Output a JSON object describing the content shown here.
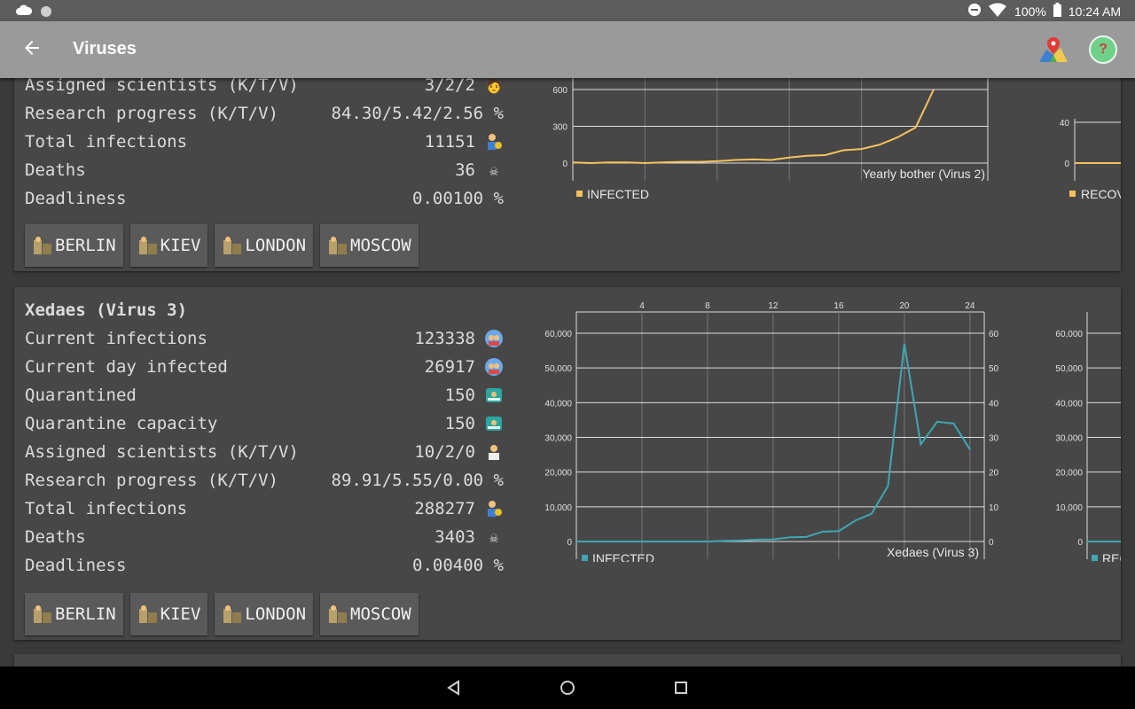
{
  "status": {
    "battery": "100%",
    "time": "10:24 AM"
  },
  "appbar": {
    "title": "Viruses",
    "back_icon": "arrow-left-icon",
    "map_icon": "map-pin-icon",
    "help_label": "?"
  },
  "card_top": {
    "rows": [
      {
        "label": "Assigned scientists (K/T/V)",
        "value": "3/2/2",
        "icon": "scientist-icon"
      },
      {
        "label": "Research progress (K/T/V)",
        "value": "84.30/5.42/2.56 %",
        "icon": ""
      },
      {
        "label": "Total infections",
        "value": "11151",
        "icon": "person-virus-icon"
      },
      {
        "label": "Deaths",
        "value": "36",
        "icon": "skull-icon"
      },
      {
        "label": "Deadliness",
        "value": "0.00100 %",
        "icon": ""
      }
    ],
    "buttons": [
      "BERLIN",
      "KIEV",
      "LONDON",
      "MOSCOW"
    ],
    "chart_caption": "Yearly bother (Virus 2)",
    "legend_infected": "INFECTED",
    "legend_recovered": "RECOVI"
  },
  "card_virus3": {
    "title": "Xedaes (Virus 3)",
    "rows": [
      {
        "label": "Current infections",
        "value": "123338",
        "icon": "people-icon"
      },
      {
        "label": "Current day infected",
        "value": "26917",
        "icon": "people-icon"
      },
      {
        "label": "Quarantined",
        "value": "150",
        "icon": "quarantine-icon"
      },
      {
        "label": "Quarantine capacity",
        "value": "150",
        "icon": "quarantine-icon"
      },
      {
        "label": "Assigned scientists (K/T/V)",
        "value": "10/2/0",
        "icon": "scientist-icon"
      },
      {
        "label": "Research progress (K/T/V)",
        "value": "89.91/5.55/0.00 %",
        "icon": ""
      },
      {
        "label": "Total infections",
        "value": "288277",
        "icon": "person-virus-icon"
      },
      {
        "label": "Deaths",
        "value": "3403",
        "icon": "skull-icon"
      },
      {
        "label": "Deadliness",
        "value": "0.00400 %",
        "icon": ""
      }
    ],
    "buttons": [
      "BERLIN",
      "KIEV",
      "LONDON",
      "MOSCOW"
    ],
    "chart_caption": "Xedaes (Virus 3)",
    "legend_infected": "INFECTED",
    "legend_recovered": "RECO"
  },
  "chart_data": [
    {
      "type": "line",
      "title": "Yearly bother (Virus 2)",
      "series": [
        {
          "name": "INFECTED",
          "color": "#f5c15c",
          "x": [
            1,
            2,
            3,
            4,
            5,
            6,
            7,
            8,
            9,
            10,
            11,
            12,
            13,
            14,
            15,
            16,
            17,
            18,
            19,
            20,
            21
          ],
          "values": [
            5,
            0,
            5,
            5,
            0,
            5,
            10,
            10,
            15,
            25,
            30,
            25,
            45,
            60,
            65,
            105,
            115,
            150,
            210,
            290,
            600
          ]
        }
      ],
      "ylim": [
        0,
        600
      ],
      "yticks": [
        0,
        300,
        600
      ],
      "grid": true
    },
    {
      "type": "line",
      "title": "",
      "series": [
        {
          "name": "RECOVI",
          "color": "#f5c15c",
          "values": [
            0,
            0,
            0,
            0,
            0
          ]
        }
      ],
      "yticks": [
        0,
        40
      ]
    },
    {
      "type": "line",
      "title": "Xedaes (Virus 3)",
      "series": [
        {
          "name": "INFECTED",
          "color": "#3ea7b3",
          "x": [
            1,
            2,
            3,
            4,
            5,
            6,
            7,
            8,
            9,
            10,
            11,
            12,
            13,
            14,
            15,
            16,
            17,
            18,
            19,
            20,
            21,
            22,
            23,
            24,
            25
          ],
          "values": [
            0,
            0,
            0,
            0,
            0,
            0,
            0,
            0,
            0,
            200,
            300,
            500,
            600,
            1200,
            1300,
            2800,
            3000,
            6000,
            8000,
            16000,
            57000,
            28000,
            34500,
            34000,
            26500
          ]
        }
      ],
      "ylim": [
        0,
        60000
      ],
      "yticks": [
        0,
        10000,
        20000,
        30000,
        40000,
        50000,
        60000
      ],
      "xticks": [
        4,
        8,
        12,
        16,
        20,
        24
      ],
      "grid": true
    },
    {
      "type": "line",
      "title": "",
      "series": [
        {
          "name": "RECO",
          "color": "#3ea7b3",
          "values": [
            0,
            0,
            0,
            0
          ]
        }
      ],
      "yticks": [
        0,
        10000,
        20000,
        30000,
        40000,
        50000,
        60000
      ]
    }
  ]
}
